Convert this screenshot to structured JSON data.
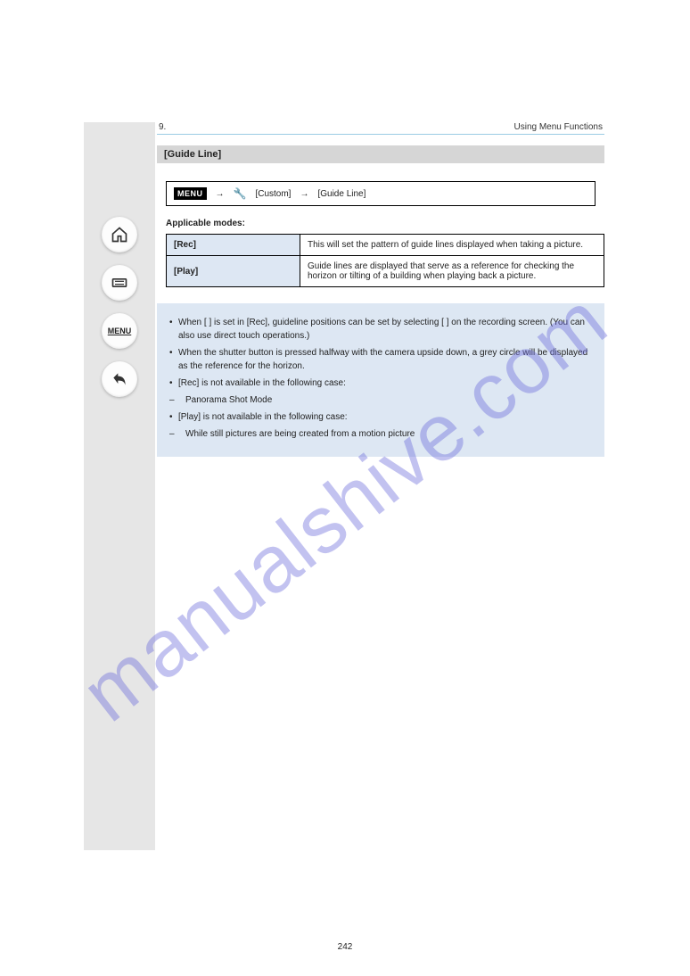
{
  "header": {
    "chapter": "9.",
    "chapter_title": "Using Menu Functions",
    "page_number": "242"
  },
  "section_title": "[Guide Line]",
  "menu_path": {
    "badge": "MENU",
    "wrench_label": "wrench-icon",
    "arrow1": "→",
    "step1": "[Custom]",
    "arrow2": "→",
    "step2": "[Guide Line]"
  },
  "applicable": {
    "label": "Applicable modes:",
    "modes": ""
  },
  "table": {
    "rows": [
      {
        "label": "[Rec]",
        "value": "This will set the pattern of guide lines displayed when taking a picture."
      },
      {
        "label": "[Play]",
        "value": "Guide lines are displayed that serve as a reference for checking the horizon or tilting of a building when playing back a picture."
      }
    ]
  },
  "info": {
    "items": [
      "When [   ] is set in [Rec], guideline positions can be set by selecting [   ] on the recording screen. (You can also use direct touch operations.)",
      "When the shutter button is pressed halfway with the camera upside down, a grey circle will be displayed as the reference for the horizon.",
      "[Rec] is not available in the following case:",
      {
        "sub": "Panorama Shot Mode"
      },
      "[Play] is not available in the following case:",
      {
        "sub": "While still pictures are being created from a motion picture"
      }
    ]
  },
  "watermark": "manualshive.com"
}
